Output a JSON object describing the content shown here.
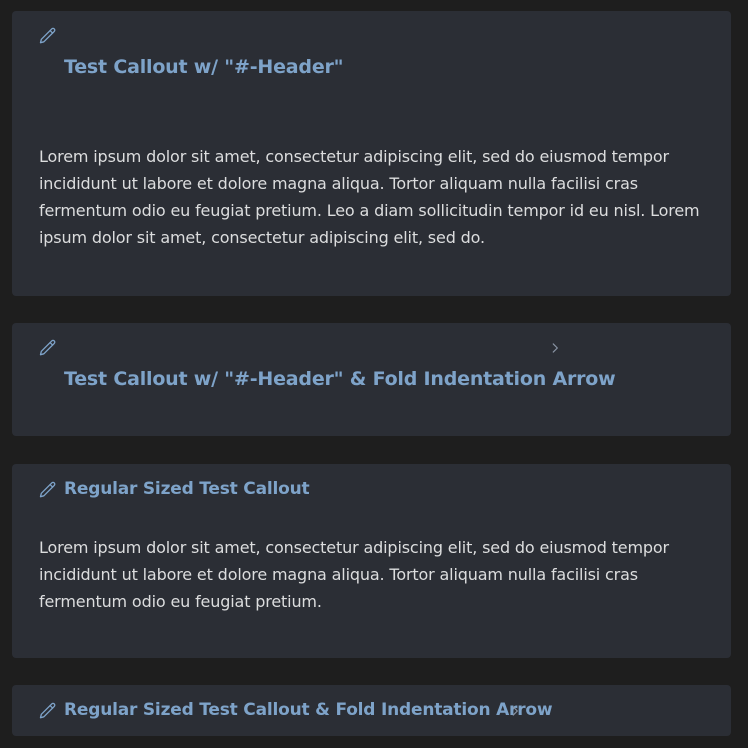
{
  "callouts": [
    {
      "icon": "pencil-icon",
      "title": "Test Callout w/ \"#-Header\"",
      "body": "Lorem ipsum dolor sit amet, consectetur adipiscing elit, sed do eiusmod tempor incididunt ut labore et dolore magna aliqua. Tortor aliquam nulla facilisi cras fermentum odio eu feugiat pretium. Leo a diam sollicitudin tempor id eu nisl. Lorem ipsum dolor sit amet, consectetur adipiscing elit, sed do."
    },
    {
      "icon": "pencil-icon",
      "title": "Test Callout w/ \"#-Header\" & Fold Indentation Arrow",
      "fold_icon": "chevron-right-icon"
    },
    {
      "icon": "pencil-icon",
      "title": "Regular Sized Test Callout",
      "body": "Lorem ipsum dolor sit amet, consectetur adipiscing elit, sed do eiusmod tempor incididunt ut labore et dolore magna aliqua. Tortor aliquam nulla facilisi cras fermentum odio eu feugiat pretium."
    },
    {
      "icon": "pencil-icon",
      "title": "Regular Sized Test Callout & Fold Indentation Arrow",
      "fold_icon": "chevron-right-icon"
    }
  ],
  "colors": {
    "page_background": "#1e1e1e",
    "callout_background": "#2b2e35",
    "accent": "#7ea3c9",
    "body_text": "#dcddde"
  }
}
